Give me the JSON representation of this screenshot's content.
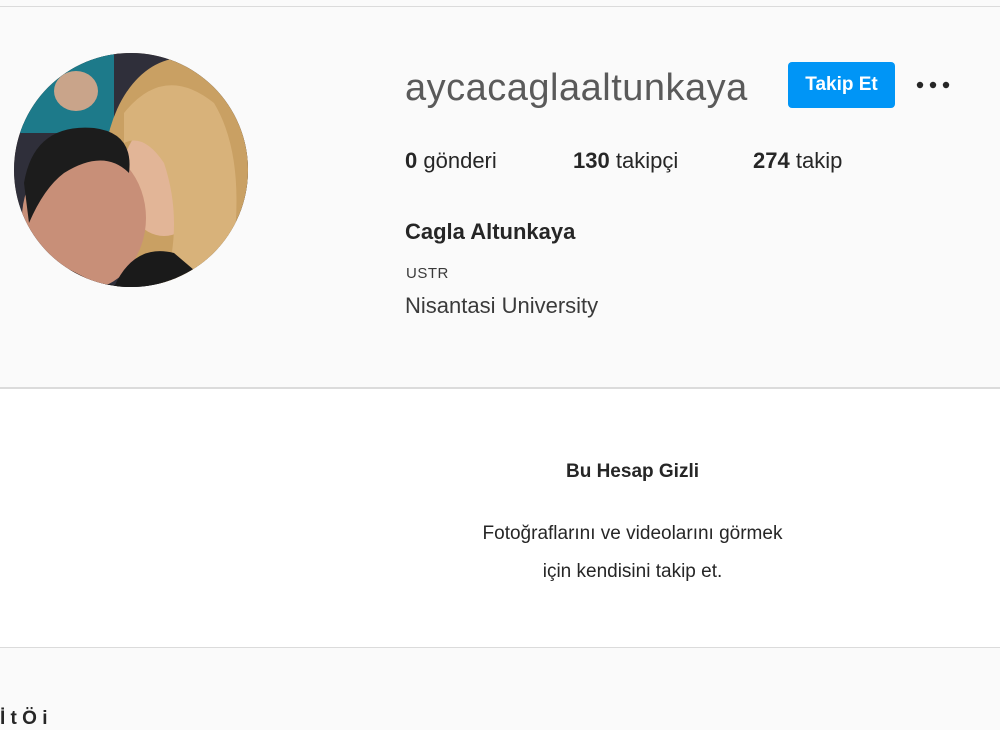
{
  "profile": {
    "username": "aycacaglaaltunkaya",
    "follow_label": "Takip Et",
    "more_icon": "more-options-icon",
    "stats": {
      "posts_count": "0",
      "posts_label": "gönderi",
      "followers_count": "130",
      "followers_label": "takipçi",
      "following_count": "274",
      "following_label": "takip"
    },
    "full_name": "Cagla Altunkaya",
    "category": "USTR",
    "bio": "Nisantasi University"
  },
  "private_account": {
    "title": "Bu Hesap Gizli",
    "line1": "Fotoğraflarını ve videolarını görmek",
    "line2": "için kendisini takip et."
  },
  "footer": {
    "partial_text": "İ t Ö i"
  },
  "colors": {
    "accent": "#0095f6",
    "background": "#fafafa",
    "border": "#dbdbdb"
  }
}
